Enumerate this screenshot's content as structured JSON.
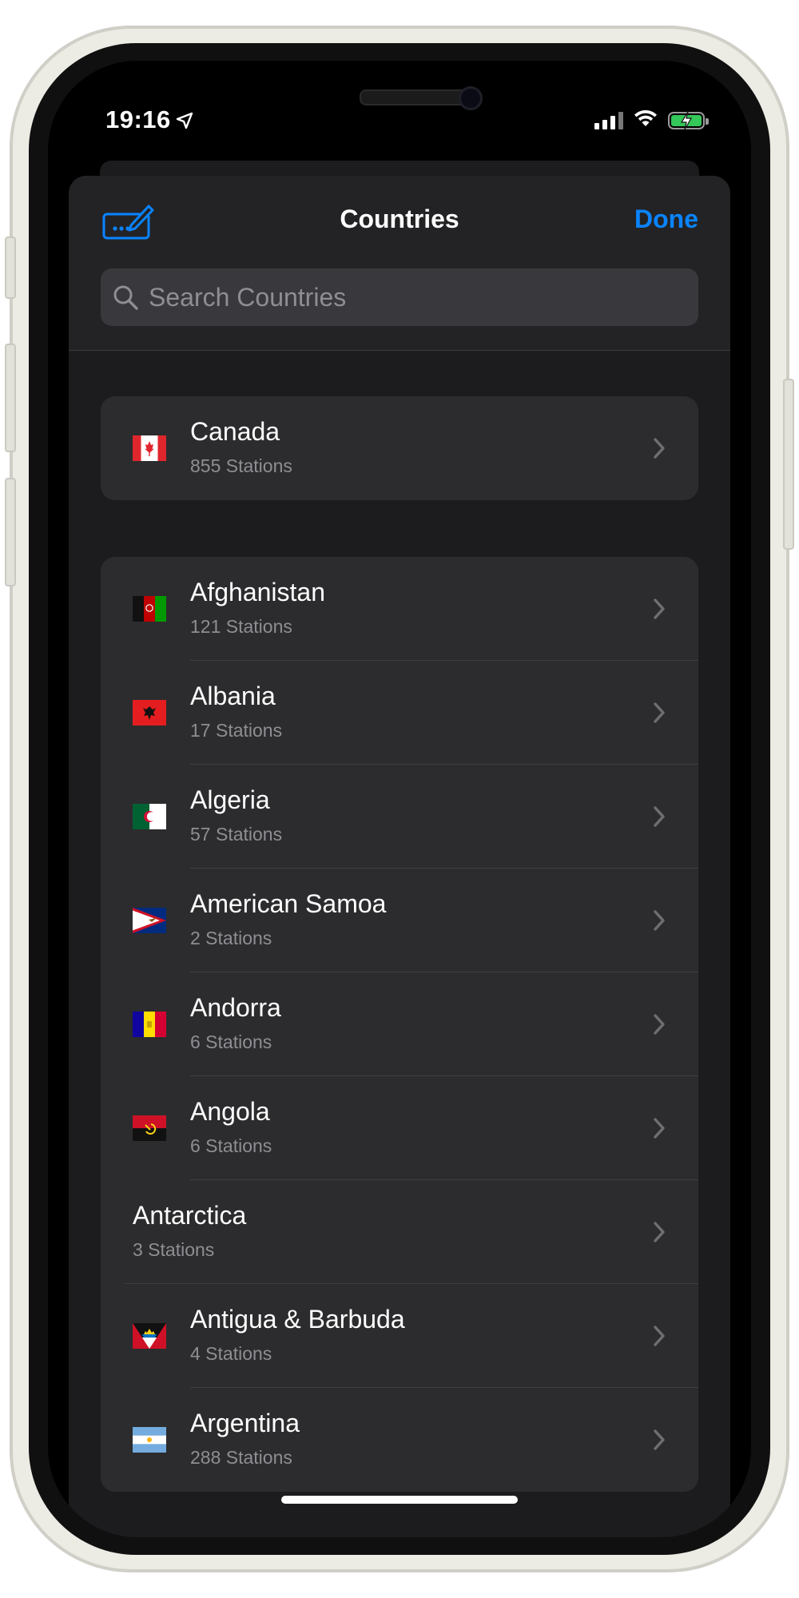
{
  "status_bar": {
    "time": "19:16"
  },
  "header": {
    "title": "Countries",
    "done_label": "Done",
    "search_placeholder": "Search Countries"
  },
  "featured": [
    {
      "name": "Canada",
      "count": "855 Stations",
      "flag": "canada-flag"
    }
  ],
  "countries": [
    {
      "name": "Afghanistan",
      "count": "121 Stations",
      "flag": "afghanistan-flag"
    },
    {
      "name": "Albania",
      "count": "17 Stations",
      "flag": "albania-flag"
    },
    {
      "name": "Algeria",
      "count": "57 Stations",
      "flag": "algeria-flag"
    },
    {
      "name": "American Samoa",
      "count": "2 Stations",
      "flag": "american-samoa-flag"
    },
    {
      "name": "Andorra",
      "count": "6 Stations",
      "flag": "andorra-flag"
    },
    {
      "name": "Angola",
      "count": "6 Stations",
      "flag": "angola-flag"
    },
    {
      "name": "Antarctica",
      "count": "3 Stations",
      "flag": ""
    },
    {
      "name": "Antigua & Barbuda",
      "count": "4 Stations",
      "flag": "antigua-barbuda-flag"
    },
    {
      "name": "Argentina",
      "count": "288 Stations",
      "flag": "argentina-flag"
    }
  ],
  "colors": {
    "accent": "#0a84ff",
    "sheet_bg": "#1c1c1e",
    "cell_bg": "#2c2c2e",
    "secondary_text": "#8e8e93"
  }
}
